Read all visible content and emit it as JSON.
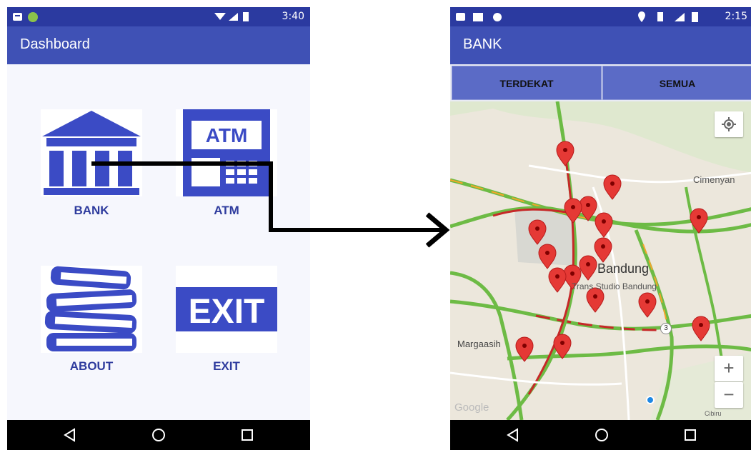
{
  "left_screen": {
    "status_bar": {
      "time": "3:40"
    },
    "app_bar": {
      "title": "Dashboard"
    },
    "tiles": [
      {
        "label": "BANK",
        "icon": "bank-icon"
      },
      {
        "label": "ATM",
        "icon": "atm-icon",
        "icon_text": "ATM"
      },
      {
        "label": "ABOUT",
        "icon": "books-icon"
      },
      {
        "label": "EXIT",
        "icon": "exit-icon",
        "icon_text": "EXIT"
      }
    ]
  },
  "right_screen": {
    "status_bar": {
      "time": "2:15"
    },
    "app_bar": {
      "title": "BANK"
    },
    "tabs": [
      {
        "label": "TERDEKAT"
      },
      {
        "label": "SEMUA"
      }
    ],
    "map": {
      "labels": {
        "city": "Bandung",
        "poi": "Trans Studio Bandung",
        "district_1": "Cimenyan",
        "district_2": "Margaasih",
        "district_3": "Cibiru",
        "road_shield": "3",
        "attribution": "Google"
      },
      "zoom_in": "+",
      "zoom_out": "−",
      "marker_count": 19
    }
  },
  "colors": {
    "primary": "#3f51b5",
    "primary_dark": "#2b3aa0",
    "tab": "#5b6bc6",
    "icon_blue": "#3b4bc5",
    "label_blue": "#2f3c9e",
    "marker_red": "#e53935"
  },
  "nav_icons": [
    "back-icon",
    "home-icon",
    "recents-icon"
  ]
}
